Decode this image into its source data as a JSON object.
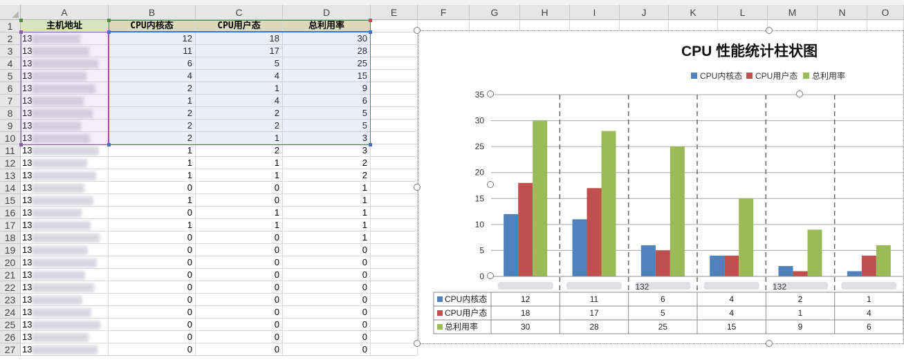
{
  "sheet": {
    "columns": [
      "A",
      "B",
      "C",
      "D",
      "E",
      "F",
      "G",
      "H",
      "I",
      "J",
      "K",
      "L",
      "M",
      "N",
      "O"
    ],
    "rows": [
      "1",
      "2",
      "3",
      "4",
      "5",
      "6",
      "7",
      "8",
      "9",
      "10",
      "11",
      "12",
      "13",
      "14",
      "15",
      "16",
      "17",
      "18",
      "19",
      "20",
      "21",
      "22",
      "23",
      "24",
      "25",
      "26",
      "27"
    ],
    "headers": [
      "主机地址",
      "CPU内核态",
      "CPU用户态",
      "总利用率"
    ],
    "a_column_visible": [
      "13",
      "13",
      "13",
      "13",
      "13",
      "13",
      "13",
      "13",
      "13",
      "13",
      "13",
      "13",
      "13",
      "13",
      "13",
      "13",
      "13",
      "13",
      "13",
      "13",
      "13",
      "13",
      "13",
      "13",
      "13",
      "13",
      "132."
    ],
    "a_column_suffix": [
      "",
      "",
      "",
      "",
      "",
      "",
      "",
      "",
      "",
      "",
      "",
      "",
      "",
      "",
      "",
      "",
      "",
      "",
      "",
      "",
      "",
      "",
      "",
      "",
      "",
      "",
      "",
      "9",
      "70"
    ],
    "table": [
      [
        12,
        18,
        30
      ],
      [
        11,
        17,
        28
      ],
      [
        6,
        5,
        25
      ],
      [
        4,
        4,
        15
      ],
      [
        2,
        1,
        9
      ],
      [
        1,
        4,
        6
      ],
      [
        2,
        2,
        5
      ],
      [
        2,
        2,
        5
      ],
      [
        2,
        1,
        3
      ],
      [
        1,
        2,
        3
      ],
      [
        1,
        1,
        2
      ],
      [
        1,
        1,
        2
      ],
      [
        0,
        0,
        1
      ],
      [
        1,
        0,
        1
      ],
      [
        0,
        1,
        1
      ],
      [
        1,
        1,
        1
      ],
      [
        0,
        0,
        1
      ],
      [
        0,
        0,
        0
      ],
      [
        0,
        0,
        0
      ],
      [
        0,
        0,
        0
      ],
      [
        0,
        0,
        0
      ],
      [
        0,
        0,
        0
      ],
      [
        0,
        0,
        0
      ],
      [
        0,
        0,
        0
      ],
      [
        0,
        0,
        0
      ],
      [
        0,
        0,
        0
      ]
    ]
  },
  "chart_data": {
    "type": "bar",
    "title": "CPU 性能统计柱状图",
    "categories": [
      "",
      "",
      "132",
      "",
      "132",
      ""
    ],
    "series": [
      {
        "name": "CPU内核态",
        "values": [
          12,
          11,
          6,
          4,
          2,
          1
        ],
        "color": "#4f81bd"
      },
      {
        "name": "CPU用户态",
        "values": [
          18,
          17,
          5,
          4,
          1,
          4
        ],
        "color": "#c0504d"
      },
      {
        "name": "总利用率",
        "values": [
          30,
          28,
          25,
          15,
          9,
          6
        ],
        "color": "#9bbb59"
      }
    ],
    "ylim": [
      0,
      35
    ],
    "yticks": [
      "0",
      "5",
      "10",
      "15",
      "20",
      "25",
      "30",
      "35"
    ],
    "legend": "top-right",
    "data_table": true
  }
}
